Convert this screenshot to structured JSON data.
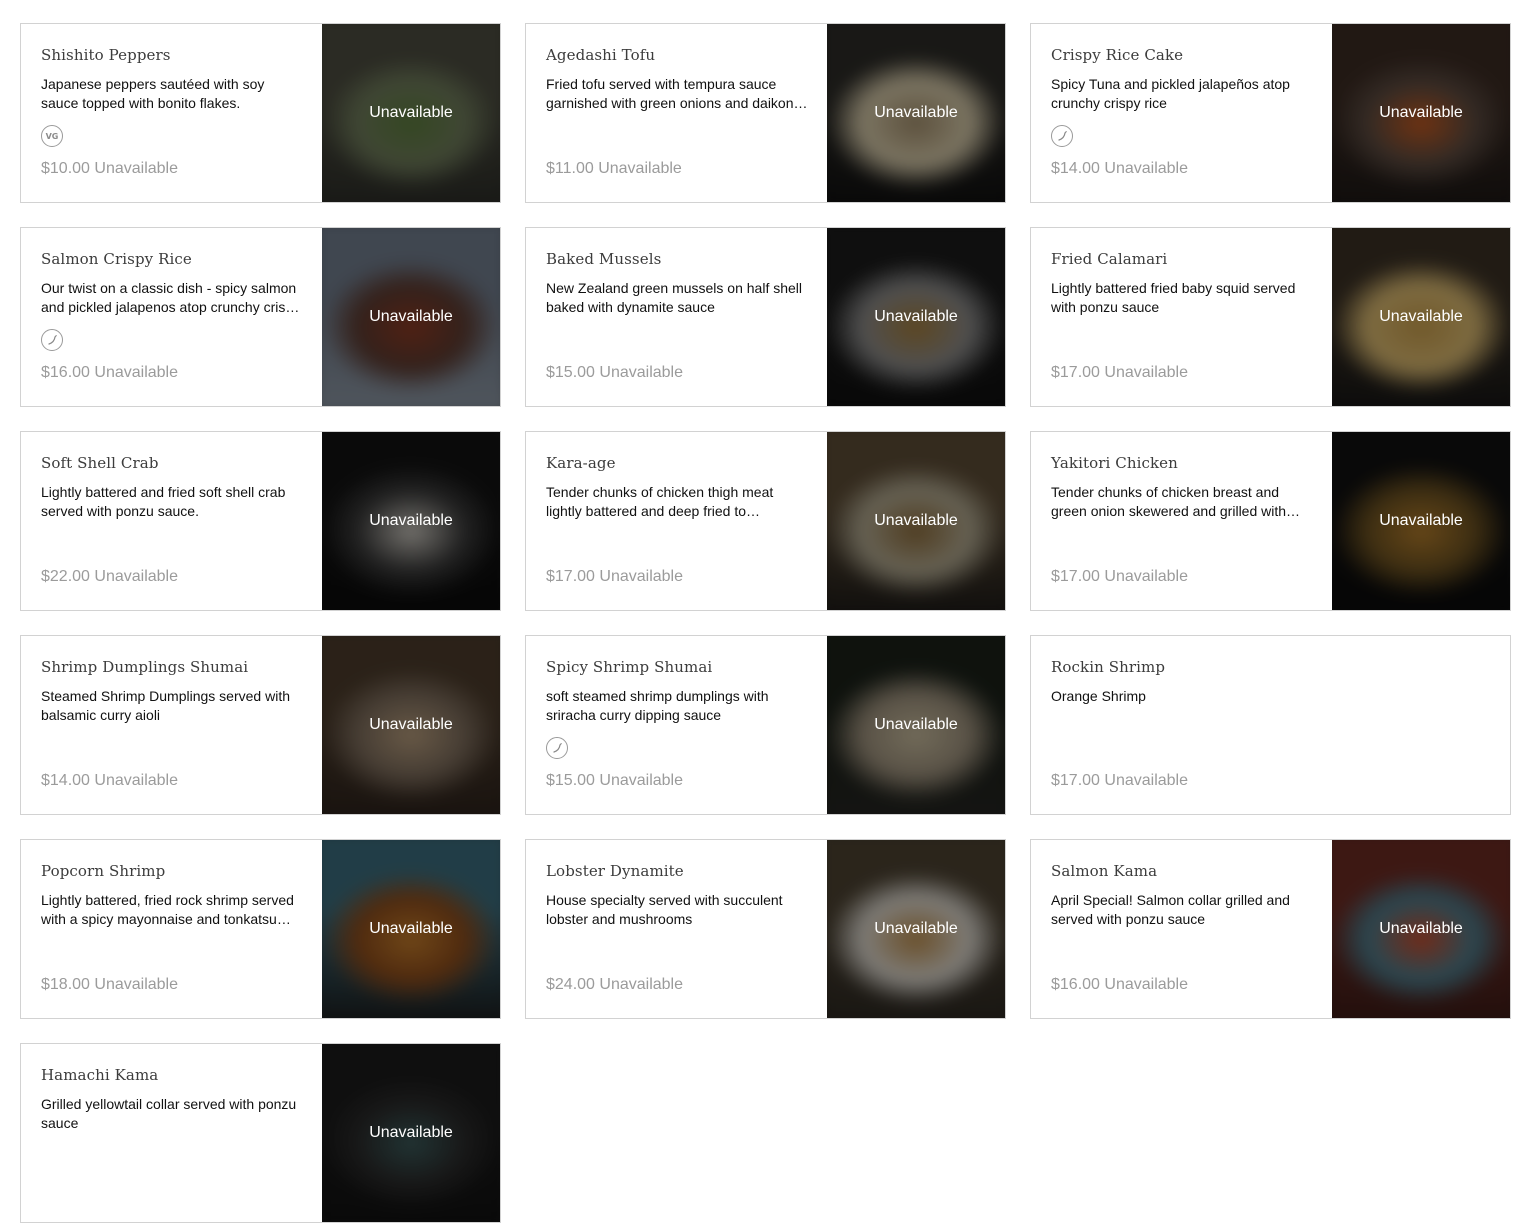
{
  "menu": {
    "unavailable_label": "Unavailable",
    "items": [
      {
        "name": "Shishito Peppers",
        "description": "Japanese peppers sautéed with soy sauce topped with bonito flakes.",
        "badge": "vegetarian",
        "badge_text": "VG",
        "price": "$10.00",
        "status": "Unavailable",
        "photo": "photo",
        "photo_colors": [
          "#4a4a3e",
          "#5b7a3c",
          "#6e7a5a",
          "#2a2b26"
        ]
      },
      {
        "name": "Agedashi Tofu",
        "description": "Fried tofu served with tempura sauce garnished with green onions and daikon radish.",
        "badge": "",
        "badge_text": "",
        "price": "$11.00",
        "status": "Unavailable",
        "photo": "photo",
        "photo_colors": [
          "#2b2a26",
          "#a08c6a",
          "#d4c8a8",
          "#0e0e0e"
        ]
      },
      {
        "name": "Crispy Rice Cake",
        "description": "Spicy Tuna and pickled jalapeños atop crunchy crispy rice",
        "badge": "spicy",
        "badge_text": "",
        "price": "$14.00",
        "status": "Unavailable",
        "photo": "photo",
        "photo_colors": [
          "#3a2a22",
          "#c0581f",
          "#5a4a40",
          "#1a1614"
        ]
      },
      {
        "name": "Salmon Crispy Rice",
        "description": "Our twist on a classic dish - spicy salmon and pickled jalapenos atop crunchy crispy rice",
        "badge": "spicy",
        "badge_text": "",
        "price": "$16.00",
        "status": "Unavailable",
        "photo": "photo",
        "photo_colors": [
          "#6e7a8a",
          "#8a3a22",
          "#5a3a30",
          "#8a94a0"
        ]
      },
      {
        "name": "Baked Mussels",
        "description": "New Zealand green mussels on half shell baked with dynamite sauce",
        "badge": "",
        "badge_text": "",
        "price": "$15.00",
        "status": "Unavailable",
        "photo": "photo",
        "photo_colors": [
          "#1a1a1a",
          "#a07a3a",
          "#8a8a8a",
          "#0e0e0e"
        ]
      },
      {
        "name": "Fried Calamari",
        "description": "Lightly battered fried baby squid served with ponzu sauce",
        "badge": "",
        "badge_text": "",
        "price": "$17.00",
        "status": "Unavailable",
        "photo": "photo",
        "photo_colors": [
          "#3a3024",
          "#c49a4a",
          "#d8b870",
          "#141414"
        ]
      },
      {
        "name": "Soft Shell Crab",
        "description": "Lightly battered and fried soft shell crab served with ponzu sauce.",
        "badge": "",
        "badge_text": "",
        "price": "$22.00",
        "status": "Unavailable",
        "photo": "photo",
        "photo_colors": [
          "#121212",
          "#c8c4bc",
          "#3a3a3a",
          "#0a0a0a"
        ]
      },
      {
        "name": "Kara-age",
        "description": "Tender chunks of chicken thigh meat lightly battered and deep fried to perfection.",
        "badge": "",
        "badge_text": "",
        "price": "$17.00",
        "status": "Unavailable",
        "photo": "photo",
        "photo_colors": [
          "#5a4a34",
          "#8a6a3a",
          "#b0a890",
          "#1a1816"
        ]
      },
      {
        "name": "Yakitori Chicken",
        "description": "Tender chunks of chicken breast and green onion skewered and grilled with teriyaki sauce.",
        "badge": "",
        "badge_text": "",
        "price": "$17.00",
        "status": "Unavailable",
        "photo": "photo",
        "photo_colors": [
          "#101010",
          "#b07a2a",
          "#6a5020",
          "#0a0a0a"
        ]
      },
      {
        "name": "Shrimp Dumplings Shumai",
        "description": "Steamed Shrimp Dumplings served with balsamic curry aioli",
        "badge": "",
        "badge_text": "",
        "price": "$14.00",
        "status": "Unavailable",
        "photo": "photo",
        "photo_colors": [
          "#4a3a2a",
          "#b49a7a",
          "#7a6a5a",
          "#2a201a"
        ]
      },
      {
        "name": "Spicy Shrimp Shumai",
        "description": "soft steamed shrimp dumplings with sriracha curry dipping sauce",
        "badge": "spicy",
        "badge_text": "",
        "price": "$15.00",
        "status": "Unavailable",
        "photo": "photo",
        "photo_colors": [
          "#1a2018",
          "#c4b89a",
          "#9a8e7a",
          "#242420"
        ]
      },
      {
        "name": "Rockin Shrimp",
        "description": "Orange Shrimp",
        "badge": "",
        "badge_text": "",
        "price": "$17.00",
        "status": "Unavailable",
        "photo": "",
        "photo_colors": []
      },
      {
        "name": "Popcorn Shrimp",
        "description": "Lightly battered, fried rock shrimp served with a spicy mayonnaise and tonkatsu sauce",
        "badge": "",
        "badge_text": "",
        "price": "$18.00",
        "status": "Unavailable",
        "photo": "photo",
        "photo_colors": [
          "#3a6a7a",
          "#c07a2a",
          "#8a4a1a",
          "#1a1a1a"
        ]
      },
      {
        "name": "Lobster Dynamite",
        "description": "House specialty served with succulent lobster and mushrooms",
        "badge": "",
        "badge_text": "",
        "price": "$24.00",
        "status": "Unavailable",
        "photo": "photo",
        "photo_colors": [
          "#4a4030",
          "#b88a4a",
          "#d8d4cc",
          "#2a2620"
        ]
      },
      {
        "name": "Salmon Kama",
        "description": "April Special! Salmon collar grilled and served with ponzu sauce",
        "badge": "",
        "badge_text": "",
        "price": "$16.00",
        "status": "Unavailable",
        "photo": "photo",
        "photo_colors": [
          "#6a2a22",
          "#c44a2a",
          "#4a7a8a",
          "#3a1a16"
        ]
      },
      {
        "name": "Hamachi Kama",
        "description": "Grilled yellowtail collar served with ponzu sauce",
        "badge": "",
        "badge_text": "",
        "price": "",
        "status": "",
        "photo": "photo",
        "photo_colors": [
          "#1a1a1a",
          "#3a5a5a",
          "#2a2a2a",
          "#101010"
        ]
      }
    ]
  }
}
